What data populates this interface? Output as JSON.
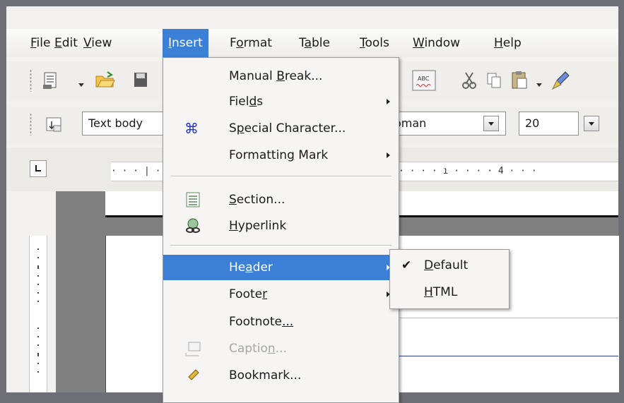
{
  "menubar": {
    "items": [
      {
        "label": "File",
        "accel": "F",
        "rest": "ile"
      },
      {
        "label": "Edit",
        "accel": "E",
        "rest": "dit"
      },
      {
        "label": "View",
        "accel": "V",
        "rest": "iew"
      },
      {
        "label": "Insert",
        "accel": "I",
        "rest": "nsert"
      },
      {
        "label": "Format",
        "pre": "F",
        "accel": "o",
        "rest": "rmat"
      },
      {
        "label": "Table",
        "pre": "T",
        "accel": "a",
        "rest": "ble"
      },
      {
        "label": "Tools",
        "accel": "T",
        "rest": "ools"
      },
      {
        "label": "Window",
        "accel": "W",
        "rest": "indow"
      },
      {
        "label": "Help",
        "accel": "H",
        "rest": "elp"
      }
    ]
  },
  "toolbar2": {
    "paragraph_style": "Text body",
    "font_name": "oman",
    "font_size": "20"
  },
  "ruler": {
    "text": "· · · | · · ·  . . . . . . . . .  · · · · ı · · · · 3 · · · · ı · · · · 4 · · ·"
  },
  "insert_menu": {
    "items": [
      {
        "pre": "Manual ",
        "accel": "B",
        "post": "reak..."
      },
      {
        "pre": "Fiel",
        "accel": "d",
        "post": "s"
      },
      {
        "pre": "S",
        "accel": "p",
        "post": "ecial Character..."
      },
      {
        "pre": "Formattin",
        "accel": "g",
        "post": " Mark"
      },
      {
        "pre": "",
        "accel": "S",
        "post": "ection..."
      },
      {
        "pre": "",
        "accel": "H",
        "post": "yperlink"
      },
      {
        "pre": "He",
        "accel": "a",
        "post": "der"
      },
      {
        "pre": "Foote",
        "accel": "r",
        "post": ""
      },
      {
        "pre": "Footnote",
        "accel": "...",
        "post": ""
      },
      {
        "pre": "Captio",
        "accel": "n",
        "post": "..."
      },
      {
        "pre": "Bookmark",
        "accel": "",
        "post": "..."
      }
    ]
  },
  "header_submenu": {
    "items": [
      {
        "pre": "",
        "accel": "D",
        "post": "efault",
        "checked": true
      },
      {
        "pre": "",
        "accel": "H",
        "post": "TML",
        "checked": false
      }
    ]
  },
  "colors": {
    "highlight": "#3b7fd6",
    "menu_bg": "#f6f5f3"
  }
}
